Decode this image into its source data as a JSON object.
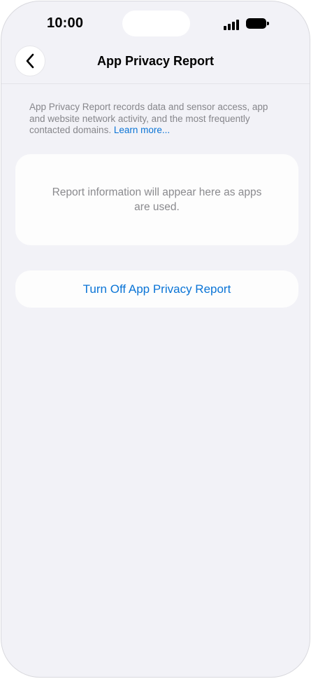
{
  "status_bar": {
    "time": "10:00",
    "signal_icon": "cellular-signal-icon",
    "battery_icon": "battery-icon"
  },
  "nav": {
    "back_icon": "chevron-left-icon",
    "title": "App Privacy Report"
  },
  "description": {
    "text": "App Privacy Report records data and sensor access, app and website network activity, and the most frequently contacted domains. ",
    "link_label": "Learn more..."
  },
  "info_card": {
    "text": "Report information will appear here as apps are used."
  },
  "action": {
    "turn_off_label": "Turn Off App Privacy Report"
  },
  "colors": {
    "background": "#f2f2f7",
    "card": "#fdfdfd",
    "accent": "#0a74d6",
    "secondary_text": "#86868b"
  }
}
